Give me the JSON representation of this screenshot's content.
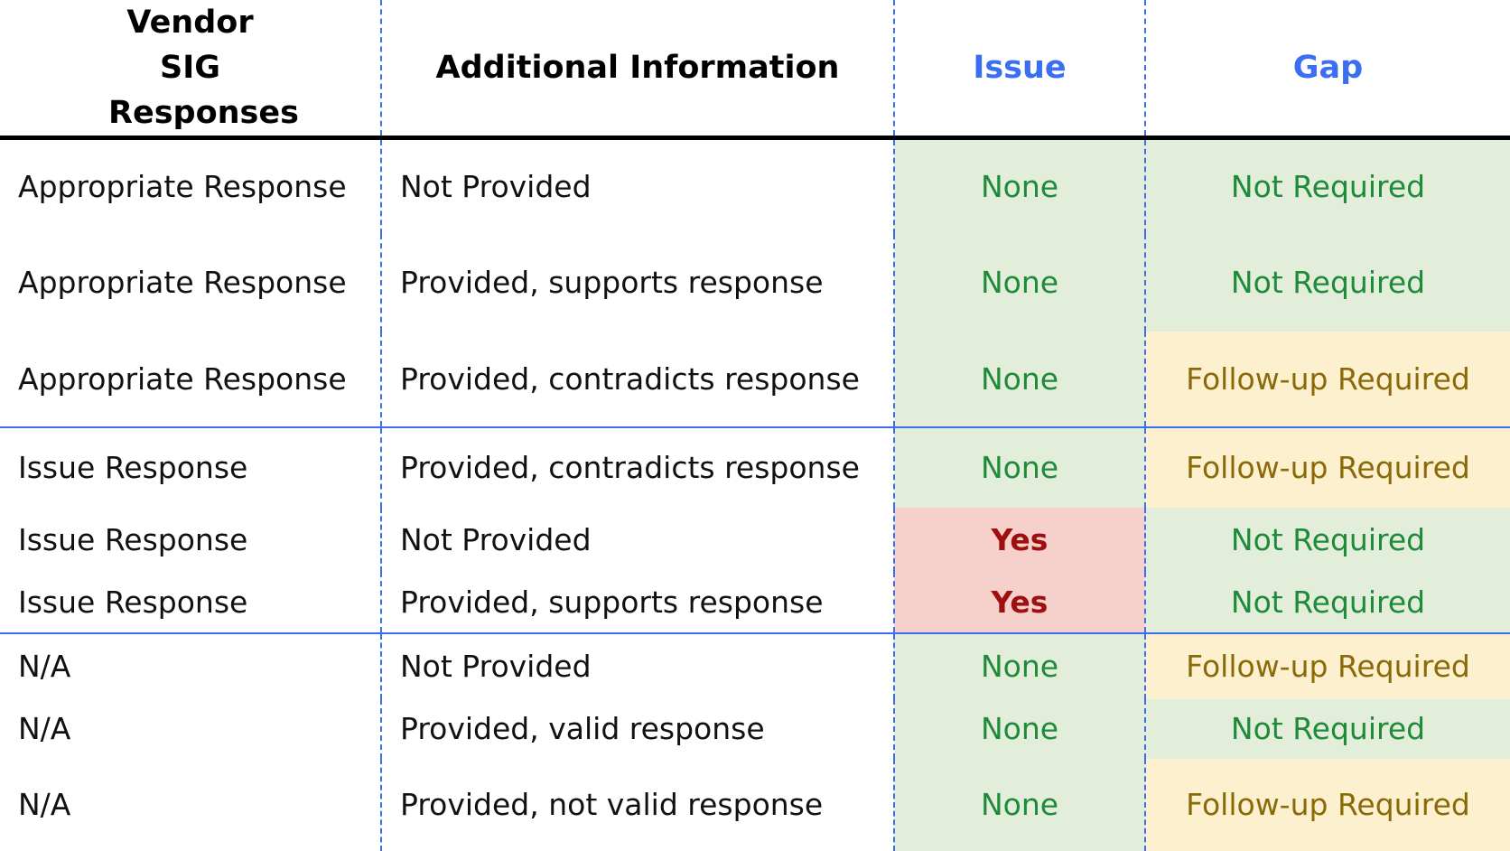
{
  "headers": [
    "Vendor SIG Responses",
    "Additional Information",
    "Issue",
    "Gap"
  ],
  "rows": [
    {
      "response": "Appropriate Response",
      "info": "Not Provided",
      "issue": "None",
      "gap": "Not Required"
    },
    {
      "response": "Appropriate Response",
      "info": "Provided, supports response",
      "issue": "None",
      "gap": "Not Required"
    },
    {
      "response": "Appropriate Response",
      "info": "Provided, contradicts response",
      "issue": "None",
      "gap": "Follow-up Required"
    },
    {
      "response": "Issue Response",
      "info": "Provided, contradicts response",
      "issue": "None",
      "gap": "Follow-up Required"
    },
    {
      "response": "Issue Response",
      "info": "Not Provided",
      "issue": "Yes",
      "gap": "Not Required"
    },
    {
      "response": "Issue Response",
      "info": "Provided, supports response",
      "issue": "Yes",
      "gap": "Not Required"
    },
    {
      "response": "N/A",
      "info": "Not Provided",
      "issue": "None",
      "gap": "Follow-up Required"
    },
    {
      "response": "N/A",
      "info": "Provided, valid response",
      "issue": "None",
      "gap": "Not Required"
    },
    {
      "response": "N/A",
      "info": "Provided, not valid response",
      "issue": "None",
      "gap": "Follow-up Required"
    }
  ],
  "colors": {
    "accent": "#3a6ff2",
    "ok_bg": "#e2eed9",
    "followup_bg": "#fcf0cf",
    "issue_bg": "#f6d1cc"
  }
}
